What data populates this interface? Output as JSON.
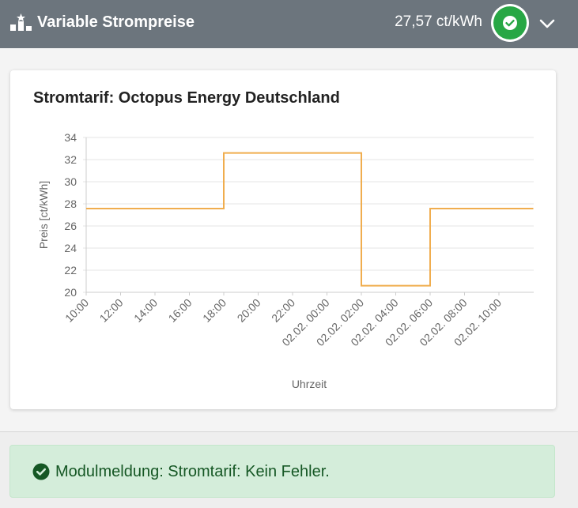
{
  "header": {
    "title": "Variable Strompreise",
    "current_price": "27,57 ct/kWh",
    "status": "ok",
    "icons": {
      "logo": "podium-star-icon",
      "status": "check-circle-icon",
      "expand": "chevron-down-icon"
    }
  },
  "card": {
    "title": "Stromtarif: Octopus Energy Deutschland"
  },
  "chart_data": {
    "type": "line",
    "step": true,
    "xlabel": "Uhrzeit",
    "ylabel": "Preis [ct/kWh]",
    "ylim": [
      20,
      34
    ],
    "yticks": [
      20,
      22,
      24,
      26,
      28,
      30,
      32,
      34
    ],
    "xticks": [
      "10:00",
      "12:00",
      "14:00",
      "16:00",
      "18:00",
      "20:00",
      "22:00",
      "02.02. 00:00",
      "02.02. 02:00",
      "02.02. 04:00",
      "02.02. 06:00",
      "02.02. 08:00",
      "02.02. 10:00"
    ],
    "grid": true,
    "color": "#f0ad4e",
    "series": [
      {
        "x_hours": [
          10,
          18,
          18,
          26,
          26,
          30,
          30,
          36
        ],
        "values": [
          27.57,
          27.57,
          32.6,
          32.6,
          20.6,
          20.6,
          27.57,
          27.57
        ]
      }
    ]
  },
  "alert": {
    "text": "Modulmeldung: Stromtarif: Kein Fehler.",
    "icon": "check-circle-icon"
  }
}
